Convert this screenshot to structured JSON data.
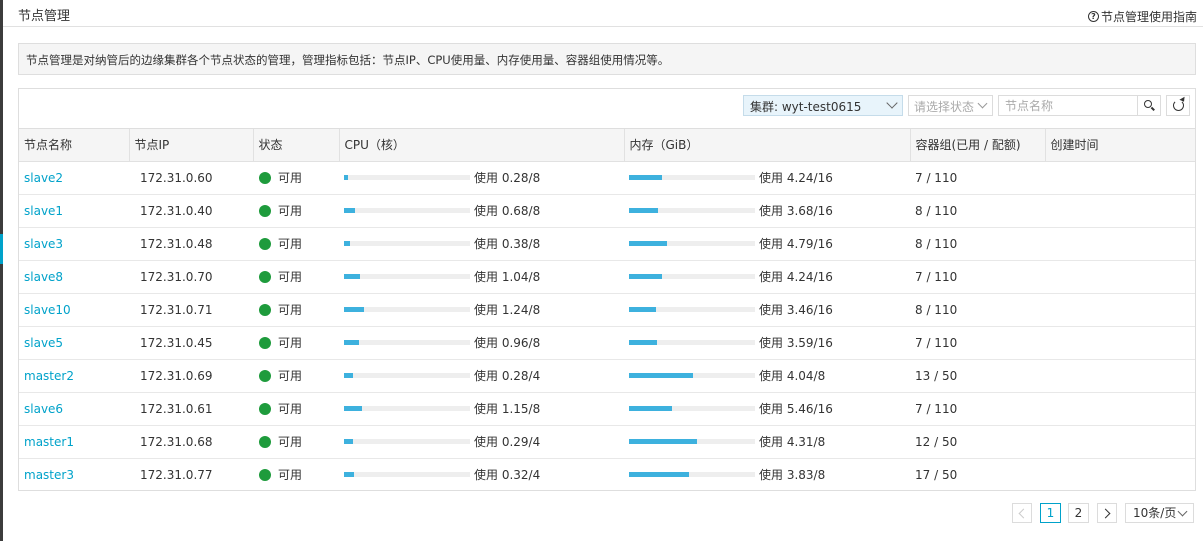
{
  "header": {
    "title": "节点管理",
    "guide_link": "节点管理使用指南"
  },
  "notice": "节点管理是对纳管后的边缘集群各个节点状态的管理，管理指标包括：节点IP、CPU使用量、内存使用量、容器组使用情况等。",
  "toolbar": {
    "cluster_label": "集群: wyt-test0615",
    "status_placeholder": "请选择状态",
    "search_placeholder": "节点名称"
  },
  "table": {
    "columns": [
      "节点名称",
      "节点IP",
      "状态",
      "CPU（核）",
      "内存（GiB）",
      "容器组(已用 / 配额)",
      "创建时间"
    ],
    "rows": [
      {
        "name": "slave2",
        "ip": "172.31.0.60",
        "status": "可用",
        "cpu_used": 0.28,
        "cpu_total": 8,
        "cpu_text": "使用 0.28/8",
        "mem_used": 4.24,
        "mem_total": 16,
        "mem_text": "使用 4.24/16",
        "pods": "7 / 110",
        "created": ""
      },
      {
        "name": "slave1",
        "ip": "172.31.0.40",
        "status": "可用",
        "cpu_used": 0.68,
        "cpu_total": 8,
        "cpu_text": "使用 0.68/8",
        "mem_used": 3.68,
        "mem_total": 16,
        "mem_text": "使用 3.68/16",
        "pods": "8 / 110",
        "created": ""
      },
      {
        "name": "slave3",
        "ip": "172.31.0.48",
        "status": "可用",
        "cpu_used": 0.38,
        "cpu_total": 8,
        "cpu_text": "使用 0.38/8",
        "mem_used": 4.79,
        "mem_total": 16,
        "mem_text": "使用 4.79/16",
        "pods": "8 / 110",
        "created": ""
      },
      {
        "name": "slave8",
        "ip": "172.31.0.70",
        "status": "可用",
        "cpu_used": 1.04,
        "cpu_total": 8,
        "cpu_text": "使用 1.04/8",
        "mem_used": 4.24,
        "mem_total": 16,
        "mem_text": "使用 4.24/16",
        "pods": "7 / 110",
        "created": ""
      },
      {
        "name": "slave10",
        "ip": "172.31.0.71",
        "status": "可用",
        "cpu_used": 1.24,
        "cpu_total": 8,
        "cpu_text": "使用 1.24/8",
        "mem_used": 3.46,
        "mem_total": 16,
        "mem_text": "使用 3.46/16",
        "pods": "8 / 110",
        "created": ""
      },
      {
        "name": "slave5",
        "ip": "172.31.0.45",
        "status": "可用",
        "cpu_used": 0.96,
        "cpu_total": 8,
        "cpu_text": "使用 0.96/8",
        "mem_used": 3.59,
        "mem_total": 16,
        "mem_text": "使用 3.59/16",
        "pods": "7 / 110",
        "created": ""
      },
      {
        "name": "master2",
        "ip": "172.31.0.69",
        "status": "可用",
        "cpu_used": 0.28,
        "cpu_total": 4,
        "cpu_text": "使用 0.28/4",
        "mem_used": 4.04,
        "mem_total": 8,
        "mem_text": "使用 4.04/8",
        "pods": "13 / 50",
        "created": ""
      },
      {
        "name": "slave6",
        "ip": "172.31.0.61",
        "status": "可用",
        "cpu_used": 1.15,
        "cpu_total": 8,
        "cpu_text": "使用 1.15/8",
        "mem_used": 5.46,
        "mem_total": 16,
        "mem_text": "使用 5.46/16",
        "pods": "7 / 110",
        "created": ""
      },
      {
        "name": "master1",
        "ip": "172.31.0.68",
        "status": "可用",
        "cpu_used": 0.29,
        "cpu_total": 4,
        "cpu_text": "使用 0.29/4",
        "mem_used": 4.31,
        "mem_total": 8,
        "mem_text": "使用 4.31/8",
        "pods": "12 / 50",
        "created": ""
      },
      {
        "name": "master3",
        "ip": "172.31.0.77",
        "status": "可用",
        "cpu_used": 0.32,
        "cpu_total": 4,
        "cpu_text": "使用 0.32/4",
        "mem_used": 3.83,
        "mem_total": 8,
        "mem_text": "使用 3.83/8",
        "pods": "17 / 50",
        "created": ""
      }
    ]
  },
  "pagination": {
    "pages": [
      "1",
      "2"
    ],
    "current": "1",
    "page_size": "10条/页"
  },
  "colors": {
    "accent": "#00a2ca",
    "bar_fill": "#3db1de",
    "status_ok": "#1e9b3c"
  }
}
